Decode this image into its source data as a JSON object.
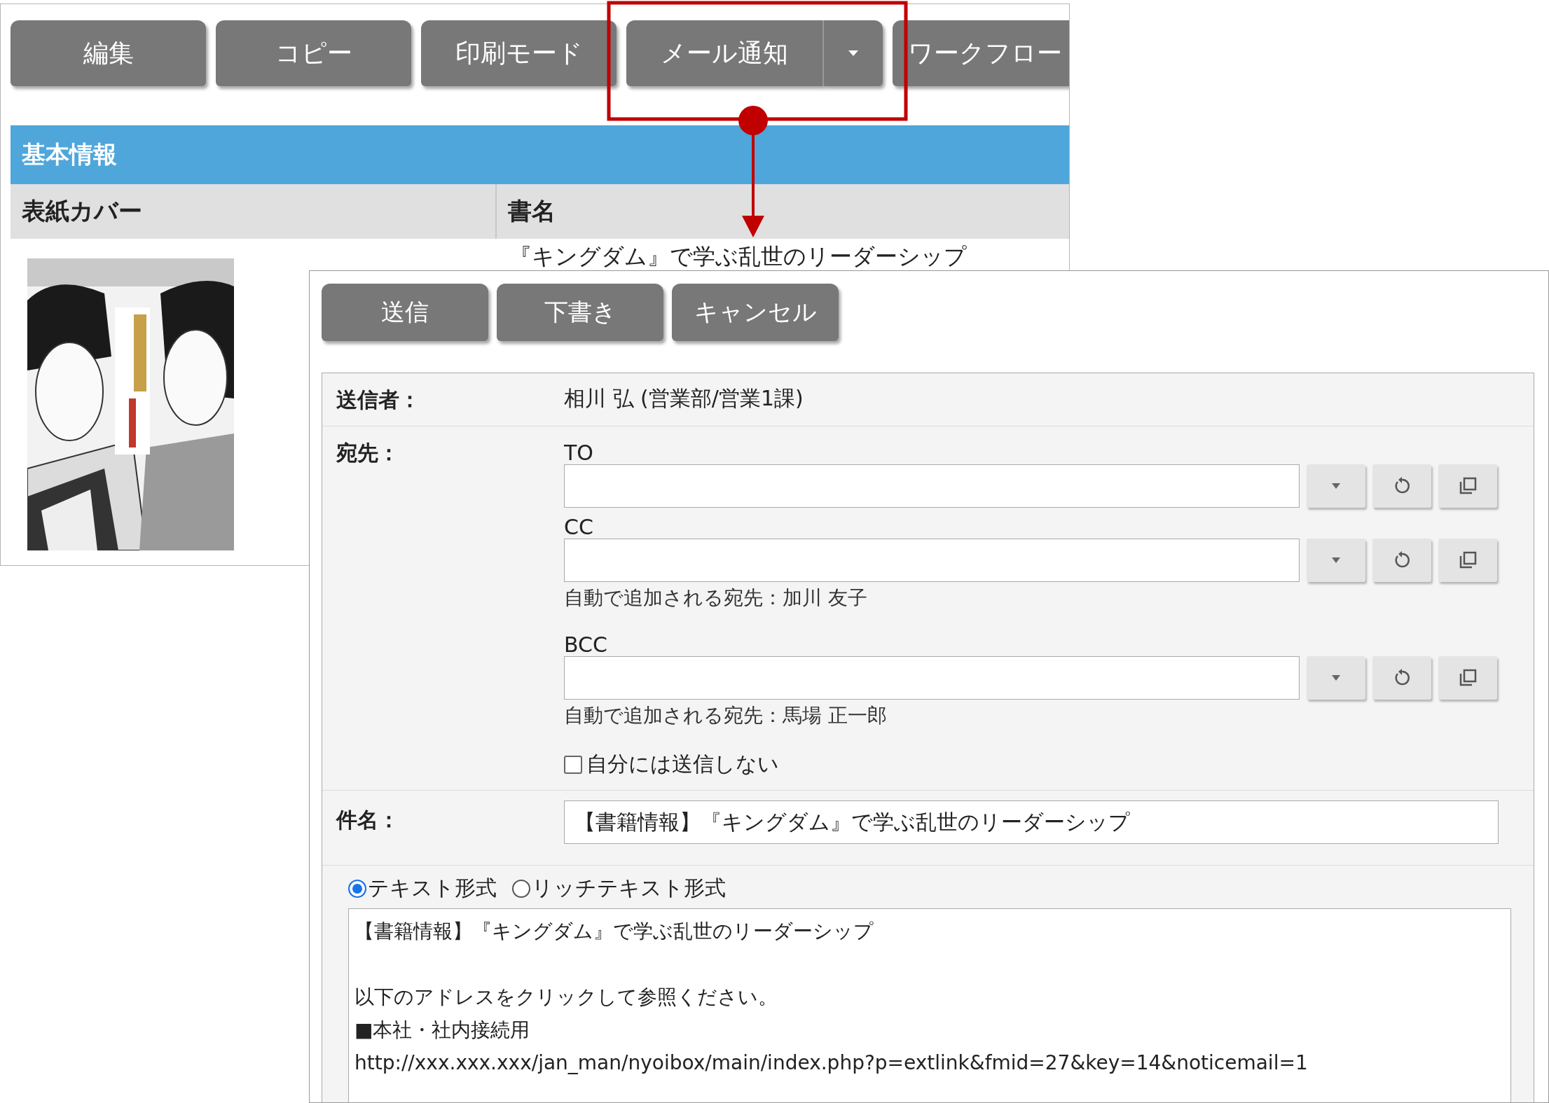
{
  "back_window": {
    "toolbar": [
      {
        "label": "編集",
        "kind": "button"
      },
      {
        "label": "コピー",
        "kind": "button"
      },
      {
        "label": "印刷モード",
        "kind": "button"
      },
      {
        "label": "メール通知",
        "kind": "split"
      },
      {
        "label": "ワークフロー",
        "kind": "button"
      }
    ],
    "section_title": "基本情報",
    "columns": [
      "表紙カバー",
      "書名"
    ],
    "row": {
      "title": "『キングダム』で学ぶ乱世のリーダーシップ"
    }
  },
  "mail_window": {
    "buttons": [
      "送信",
      "下書き",
      "キャンセル"
    ],
    "sender_label": "送信者：",
    "sender": "相川 弘 (営業部/営業1課)",
    "recipients_label": "宛先：",
    "recipients": [
      {
        "label": "TO"
      },
      {
        "label": "CC",
        "auto_note": "自動で追加される宛先：加川 友子"
      },
      {
        "label": "BCC",
        "auto_note": "自動で追加される宛先：馬場 正一郎"
      }
    ],
    "self_exclude": {
      "label": "自分には送信しない",
      "checked": false
    },
    "subject_label": "件名：",
    "subject": "【書籍情報】『キングダム』で学ぶ乱世のリーダーシップ",
    "formats": [
      {
        "label": "テキスト形式",
        "selected": true
      },
      {
        "label": "リッチテキスト形式",
        "selected": false
      }
    ],
    "body_paragraphs": [
      [
        "【書籍情報】『キングダム』で学ぶ乱世のリーダーシップ"
      ],
      [
        "以下のアドレスをクリックして参照ください。",
        "■本社・社内接続用",
        "http://xxx.xxx.xxx/jan_man/nyoibox/main/index.php?p=extlink&fmid=27&key=14&noticemail=1"
      ]
    ]
  }
}
